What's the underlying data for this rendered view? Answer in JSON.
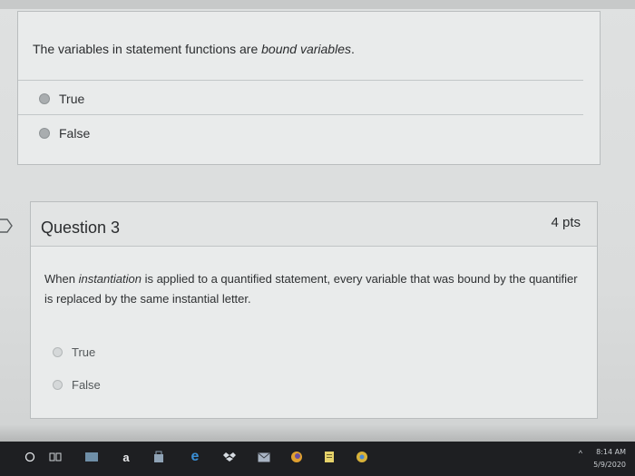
{
  "question_prev": {
    "statement": {
      "before": "The variables in statement functions are ",
      "emph": "bound variables",
      "after": "."
    },
    "options": [
      "True",
      "False"
    ]
  },
  "question3": {
    "title": "Question 3",
    "points": "4 pts",
    "statement": {
      "p1": "When ",
      "emph": "instantiation",
      "p2": " is applied to a quantified statement, every variable that was bound by the quantifier is replaced by the same instantial letter."
    },
    "options": [
      "True",
      "False"
    ]
  },
  "taskbar": {
    "time": "8:14 AM",
    "date": "5/9/2020",
    "icons": [
      "windows-icon",
      "task-view-icon",
      "files-icon",
      "amazon-icon",
      "store-icon",
      "edge-icon",
      "dropbox-icon",
      "mail-icon",
      "firefox-icon",
      "notes-icon",
      "chrome-icon"
    ]
  },
  "colors": {
    "page_bg": "#d9dbdb",
    "card_bg": "#e9ebeb",
    "taskbar": "#1e1f22"
  }
}
